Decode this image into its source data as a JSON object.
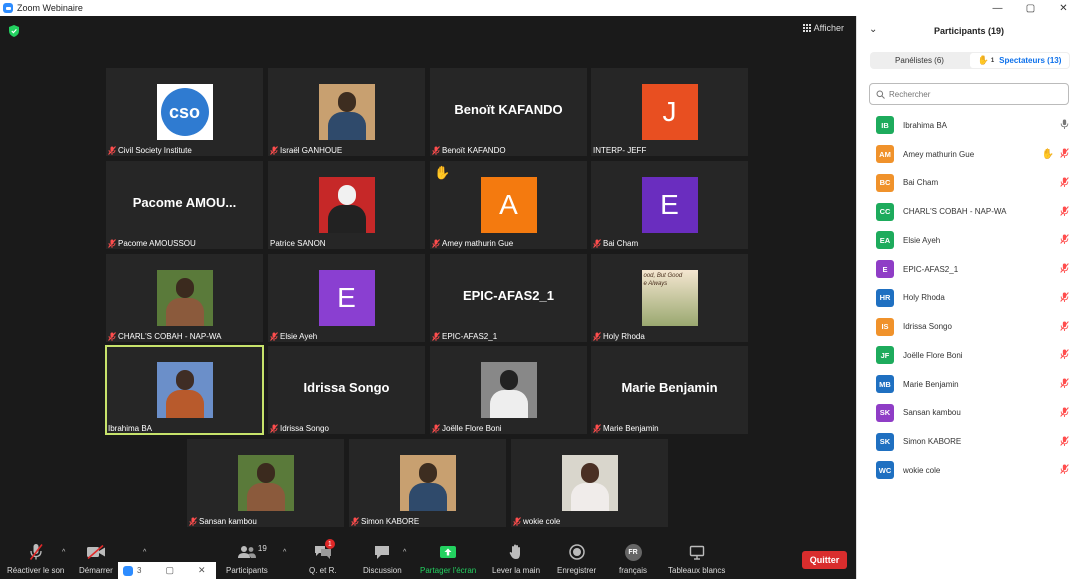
{
  "window": {
    "title": "Zoom Webinaire",
    "controls": [
      "minimize-icon",
      "maximize-icon",
      "close-icon"
    ]
  },
  "view": {
    "label": "Afficher"
  },
  "tiles": [
    {
      "name": "Civil Society Institute",
      "kind": "logo",
      "logo_text": "cso",
      "mic_muted": true
    },
    {
      "name": "Israël GANHOUE",
      "kind": "photo",
      "mic_muted": true
    },
    {
      "name": "Benoït KAFANDO",
      "kind": "text",
      "big": "Benoït KAFANDO",
      "mic_muted": true
    },
    {
      "name": "INTERP- JEFF",
      "kind": "letter",
      "letter": "J",
      "color": "#e84f21",
      "mic_muted": false
    },
    {
      "name": "Pacome AMOUSSOU",
      "kind": "text",
      "big": "Pacome AMOU...",
      "mic_muted": true
    },
    {
      "name": "Patrice SANON",
      "kind": "photo",
      "mic_muted": false
    },
    {
      "name": "Amey mathurin Gue",
      "kind": "letter",
      "letter": "A",
      "color": "#f47a0f",
      "mic_muted": true,
      "hand": true
    },
    {
      "name": "Bai Cham",
      "kind": "letter",
      "letter": "E",
      "color": "#6a2dbf",
      "mic_muted": true
    },
    {
      "name": "CHARL'S COBAH - NAP-WA",
      "kind": "photo",
      "mic_muted": true
    },
    {
      "name": "Elsie Ayeh",
      "kind": "letter",
      "letter": "E",
      "color": "#8a3fd1",
      "mic_muted": true
    },
    {
      "name": "EPIC-AFAS2_1",
      "kind": "text",
      "big": "EPIC-AFAS2_1",
      "mic_muted": true
    },
    {
      "name": "Holy Rhoda",
      "kind": "image-text",
      "overlay": "ood, But Good\ne Always",
      "mic_muted": true
    },
    {
      "name": "Ibrahima BA",
      "kind": "photo",
      "mic_muted": false,
      "active": true
    },
    {
      "name": "Idrissa Songo",
      "kind": "text",
      "big": "Idrissa Songo",
      "mic_muted": true
    },
    {
      "name": "Joëlle Flore Boni",
      "kind": "photo",
      "mic_muted": true
    },
    {
      "name": "Marie Benjamin",
      "kind": "text",
      "big": "Marie Benjamin",
      "mic_muted": true
    },
    {
      "name": "Sansan kambou",
      "kind": "photo",
      "mic_muted": true
    },
    {
      "name": "Simon KABORE",
      "kind": "photo",
      "mic_muted": true
    },
    {
      "name": "wokie cole",
      "kind": "photo",
      "mic_muted": true
    }
  ],
  "toolbar": {
    "unmute": "Réactiver le son",
    "start": "Démarrer",
    "participants": "Participants",
    "participants_count": "19",
    "qa": "Q. et R.",
    "qa_badge": "1",
    "chat": "Discussion",
    "share": "Partager l'écran",
    "raise": "Lever la main",
    "record": "Enregistrer",
    "lang_code": "FR",
    "lang": "français",
    "whiteboards": "Tableaux blancs",
    "quit": "Quitter"
  },
  "mini_window": {
    "text": "3"
  },
  "panel": {
    "title": "Participants (19)",
    "tab_panelists": "Panélistes (6)",
    "tab_attendees": "Spectateurs (13)",
    "hand_count": "1",
    "search_placeholder": "Rechercher",
    "people": [
      {
        "initials": "IB",
        "name": "Ibrahima BA",
        "color": "#1dab5c",
        "mic": "on"
      },
      {
        "initials": "AM",
        "name": "Amey mathurin Gue",
        "color": "#f0922b",
        "mic": "off",
        "hand": true
      },
      {
        "initials": "BC",
        "name": "Bai Cham",
        "color": "#f0922b",
        "mic": "off"
      },
      {
        "initials": "CC",
        "name": "CHARL'S COBAH - NAP-WA",
        "color": "#1dab5c",
        "mic": "off"
      },
      {
        "initials": "EA",
        "name": "Elsie Ayeh",
        "color": "#1dab5c",
        "mic": "off"
      },
      {
        "initials": "E",
        "name": "EPIC-AFAS2_1",
        "color": "#8f3dc6",
        "mic": "off"
      },
      {
        "initials": "HR",
        "name": "Holy Rhoda",
        "color": "#1f70c1",
        "mic": "off"
      },
      {
        "initials": "IS",
        "name": "Idrissa Songo",
        "color": "#f0922b",
        "mic": "off"
      },
      {
        "initials": "JF",
        "name": "Joëlle Flore Boni",
        "color": "#1dab5c",
        "mic": "off"
      },
      {
        "initials": "MB",
        "name": "Marie Benjamin",
        "color": "#1f70c1",
        "mic": "off"
      },
      {
        "initials": "SK",
        "name": "Sansan kambou",
        "color": "#8f3dc6",
        "mic": "off"
      },
      {
        "initials": "SK",
        "name": "Simon KABORE",
        "color": "#1f70c1",
        "mic": "off"
      },
      {
        "initials": "WC",
        "name": "wokie cole",
        "color": "#1f70c1",
        "mic": "off"
      }
    ]
  }
}
